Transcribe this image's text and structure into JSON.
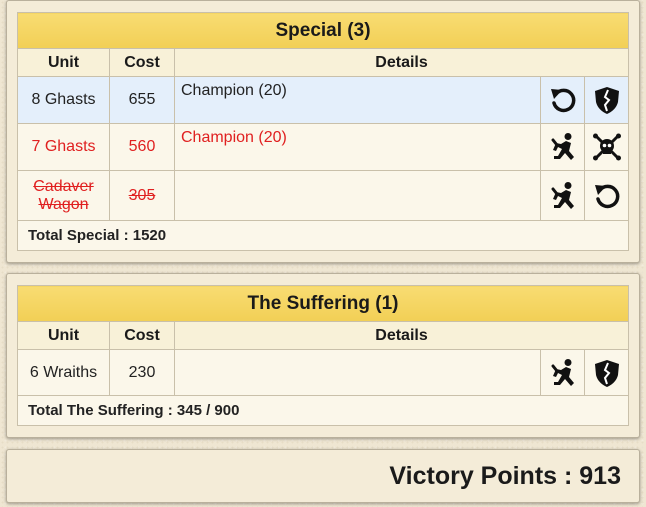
{
  "sections": [
    {
      "title": "Special (3)",
      "columns": {
        "unit": "Unit",
        "cost": "Cost",
        "details": "Details"
      },
      "rows": [
        {
          "unit": "8 Ghasts",
          "cost": "655",
          "details": "Champion (20)",
          "icons": [
            "undo-arrow-icon",
            "broken-shield-icon"
          ]
        },
        {
          "unit": "7 Ghasts",
          "cost": "560",
          "details": "Champion (20)",
          "icons": [
            "kneeling-figure-icon",
            "skull-crossbones-icon"
          ]
        },
        {
          "unit": "Cadaver Wagon",
          "cost": "305",
          "details": "",
          "icons": [
            "kneeling-figure-icon",
            "undo-arrow-icon"
          ]
        }
      ],
      "total": "Total Special : 1520"
    },
    {
      "title": "The Suffering (1)",
      "columns": {
        "unit": "Unit",
        "cost": "Cost",
        "details": "Details"
      },
      "rows": [
        {
          "unit": "6 Wraiths",
          "cost": "230",
          "details": "",
          "icons": [
            "kneeling-figure-icon",
            "broken-shield-icon"
          ]
        }
      ],
      "total": "Total The Suffering : 345 / 900"
    }
  ],
  "victory_points": "Victory Points : 913",
  "colors": {
    "header_gold": "#f2cf55",
    "invalid_red": "#e02020",
    "selected_row_blue": "#e4effb"
  }
}
